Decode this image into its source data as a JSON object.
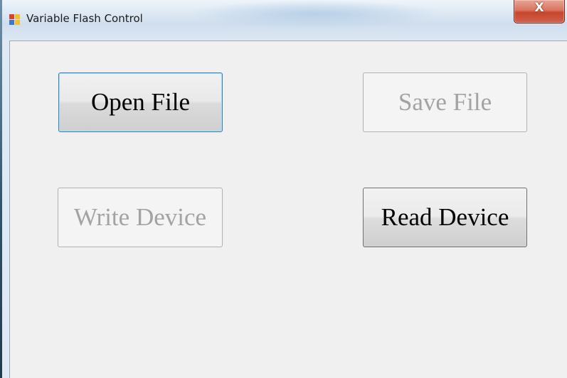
{
  "window": {
    "title": "Variable Flash Control",
    "close_glyph": "X"
  },
  "buttons": {
    "open_file": {
      "label": "Open File",
      "state": "enabled-focused"
    },
    "save_file": {
      "label": "Save File",
      "state": "disabled"
    },
    "write_device": {
      "label": "Write Device",
      "state": "disabled"
    },
    "read_device": {
      "label": "Read Device",
      "state": "enabled"
    }
  },
  "icons": {
    "app_icon": "app-window-icon",
    "close_icon": "close-icon"
  },
  "colors": {
    "close_button": "#c7452c",
    "focus_border": "#3c7fb1",
    "disabled_text": "#a3a3a3"
  }
}
